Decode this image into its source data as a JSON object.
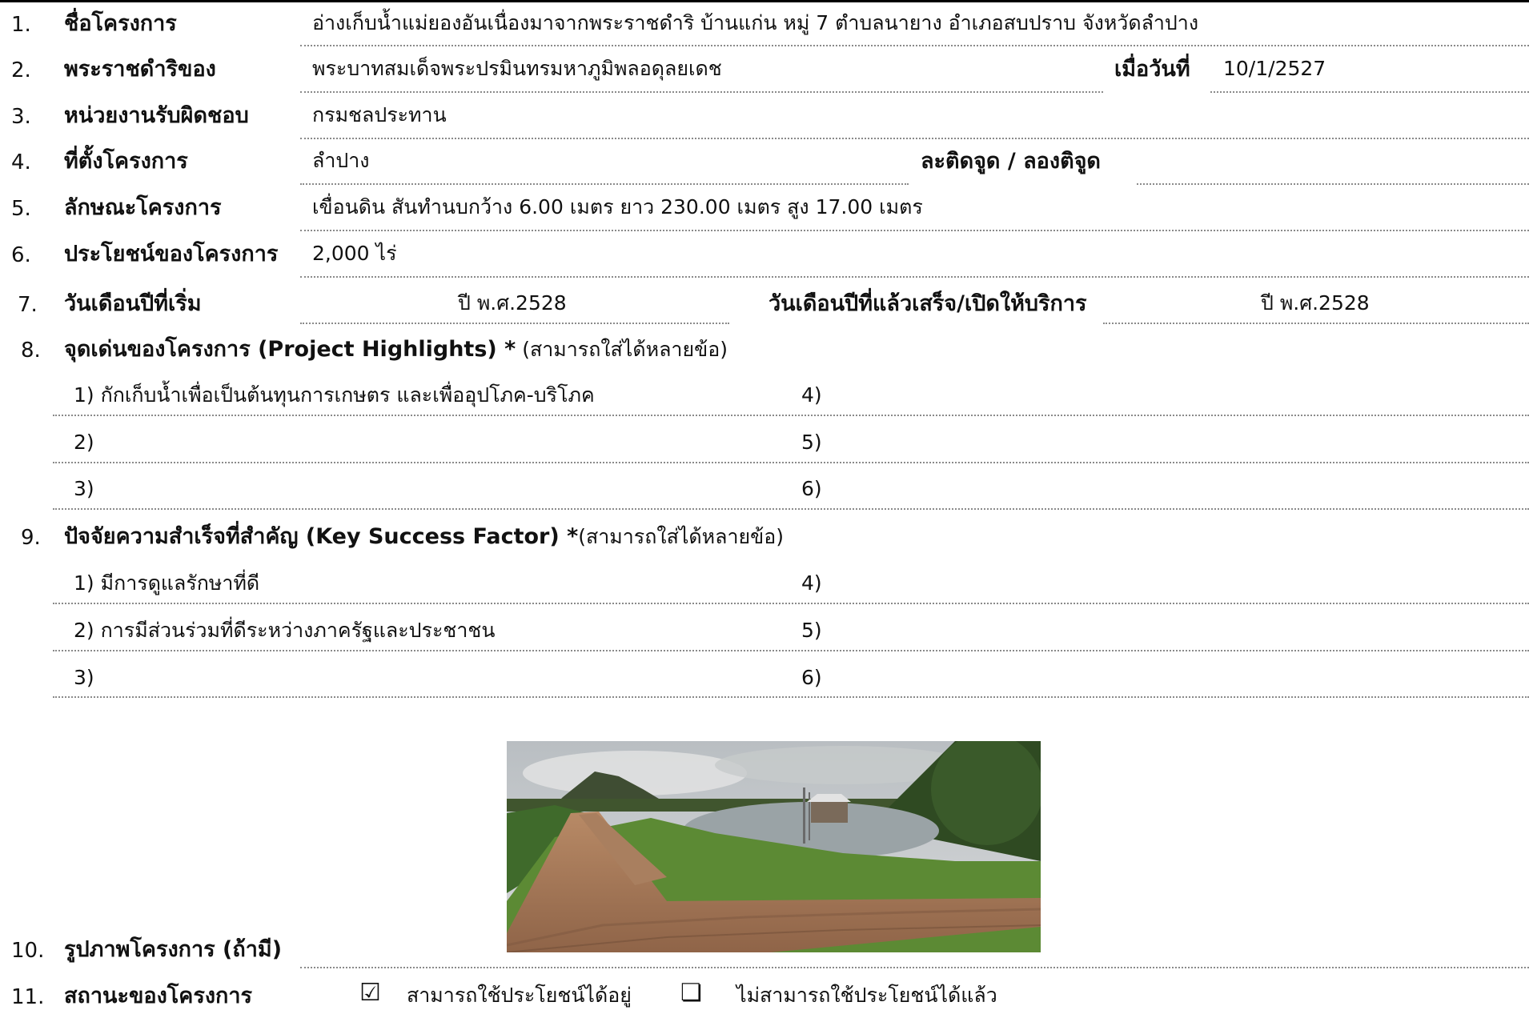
{
  "rows": {
    "r1": {
      "num": "1.",
      "label": "ชื่อโครงการ",
      "value": "อ่างเก็บน้ำแม่ยองอันเนื่องมาจากพระราชดำริ บ้านแก่น หมู่ 7 ตำบลนายาง อำเภอสบปราบ จังหวัดลำปาง"
    },
    "r2": {
      "num": "2.",
      "label": "พระราชดำริของ",
      "value": "พระบาทสมเด็จพระปรมินทรมหาภูมิพลอดุลยเดช",
      "date_label": "เมื่อวันที่",
      "date_value": "10/1/2527"
    },
    "r3": {
      "num": "3.",
      "label": "หน่วยงานรับผิดชอบ",
      "value": "กรมชลประทาน"
    },
    "r4": {
      "num": "4.",
      "label": "ที่ตั้งโครงการ",
      "value": "ลำปาง",
      "coord_label": "ละติดจูด / ลองติจูด",
      "coord_value": ""
    },
    "r5": {
      "num": "5.",
      "label": "ลักษณะโครงการ",
      "value": "เขื่อนดิน สันทำนบกว้าง 6.00 เมตร ยาว 230.00 เมตร สูง 17.00 เมตร"
    },
    "r6": {
      "num": "6.",
      "label": "ประโยชน์ของโครงการ",
      "value": "2,000 ไร่"
    },
    "r7": {
      "num": "7.",
      "label": "วันเดือนปีที่เริ่ม",
      "value": "ปี พ.ศ.2528",
      "end_label": "วันเดือนปีที่แล้วเสร็จ/เปิดให้บริการ",
      "end_value": "ปี พ.ศ.2528"
    },
    "r8": {
      "num": "8.",
      "label": "จุดเด่นของโครงการ (Project Highlights) *",
      "note": " (สามารถใส่ได้หลายข้อ)",
      "items_left": [
        "1) กักเก็บน้ำเพื่อเป็นต้นทุนการเกษตร และเพื่ออุปโภค-บริโภค",
        "2)",
        "3)"
      ],
      "items_right": [
        "4)",
        "5)",
        "6)"
      ]
    },
    "r9": {
      "num": "9.",
      "label": "ปัจจัยความสำเร็จที่สำคัญ (Key Success Factor) *",
      "note": "(สามารถใส่ได้หลายข้อ)",
      "items_left": [
        "1) มีการดูแลรักษาที่ดี",
        "2) การมีส่วนร่วมที่ดีระหว่างภาครัฐและประชาชน",
        "3)"
      ],
      "items_right": [
        "4)",
        "5)",
        "6)"
      ]
    },
    "r10": {
      "num": "10.",
      "label": "รูปภาพโครงการ (ถ้ามี)"
    },
    "r11": {
      "num": "11.",
      "label": "สถานะของโครงการ",
      "opt1_mark": "☑",
      "opt1_label": "สามารถใช้ประโยชน์ได้อยู่",
      "opt2_mark": "❏",
      "opt2_label": "ไม่สามารถใช้ประโยชน์ได้แล้ว",
      "opt1_checked": true,
      "opt2_checked": false
    }
  },
  "colors": {
    "text": "#111111",
    "rule": "#8a8a8a",
    "sky": "#c9ccce",
    "water": "#9aa3a6",
    "grass": "#5c8a34",
    "road": "#a77a57"
  }
}
